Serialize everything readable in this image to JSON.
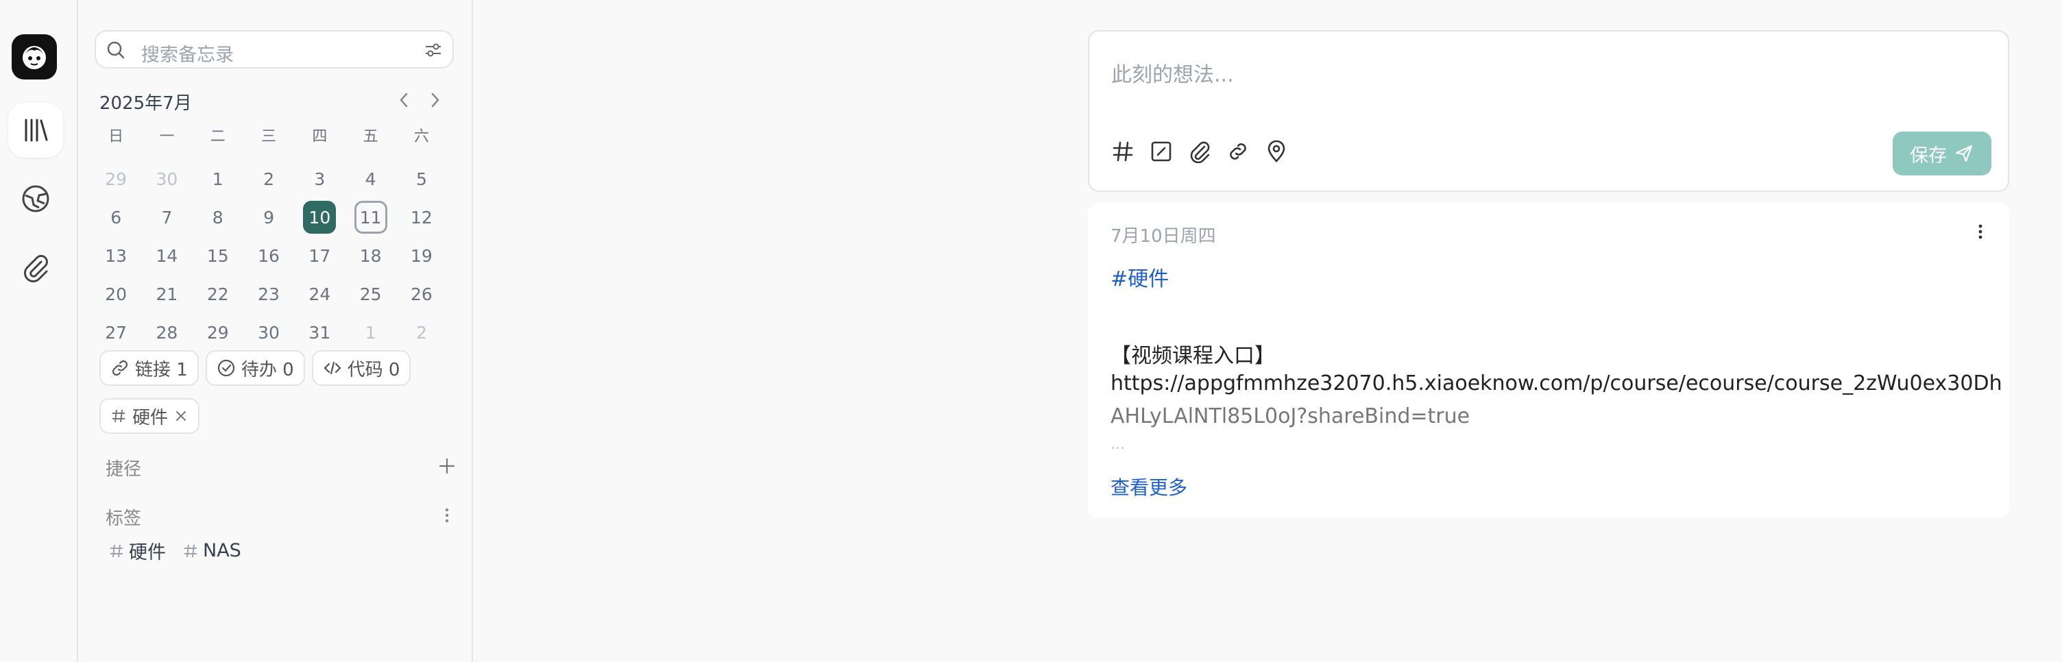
{
  "search": {
    "placeholder": "搜索备忘录"
  },
  "calendar": {
    "title": "2025年7月",
    "weekdays": [
      "日",
      "一",
      "二",
      "三",
      "四",
      "五",
      "六"
    ],
    "days": [
      "29",
      "30",
      "1",
      "2",
      "3",
      "4",
      "5",
      "6",
      "7",
      "8",
      "9",
      "10",
      "11",
      "12",
      "13",
      "14",
      "15",
      "16",
      "17",
      "18",
      "19",
      "20",
      "21",
      "22",
      "23",
      "24",
      "25",
      "26",
      "27",
      "28",
      "29",
      "30",
      "31",
      "1",
      "2"
    ],
    "selected": "10",
    "today": "11"
  },
  "stats": {
    "link_label": "链接 1",
    "todo_label": "待办 0",
    "code_label": "代码 0"
  },
  "active_tag": {
    "label": "硬件"
  },
  "shortcuts": {
    "label": "捷径"
  },
  "tags_section": {
    "label": "标签",
    "items": [
      "硬件",
      "NAS"
    ]
  },
  "editor": {
    "placeholder": "此刻的想法...",
    "save_label": "保存"
  },
  "memo": {
    "date": "7月10日周四",
    "tag": "#硬件",
    "line1": "【视频课程入口】",
    "line2": "https://appgfmmhze32070.h5.xiaoeknow.com/p/course/ecourse/course_2zWu0ex30Dh",
    "line3": "AHLyLAlNTl85L0oJ?shareBind=true",
    "ellipsis": "...",
    "see_more": "查看更多"
  },
  "colors": {
    "accent": "#2f6b63",
    "save_button": "#8fc8bf",
    "link": "#1d5fd1"
  }
}
